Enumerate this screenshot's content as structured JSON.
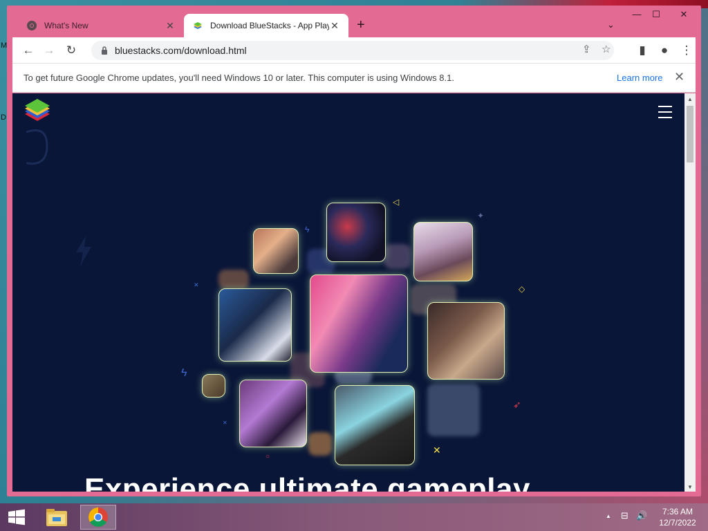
{
  "desktop": {
    "edge_letters": [
      "M",
      "D"
    ]
  },
  "window": {
    "controls": {
      "minimize": "—",
      "maximize": "☐",
      "close": "✕"
    },
    "tab_search_icon": "⌄"
  },
  "tabs": [
    {
      "title": "What's New",
      "favicon": "chrome-icon",
      "close": "✕",
      "active": false
    },
    {
      "title": "Download BlueStacks - App Player",
      "favicon": "bluestacks-icon",
      "close": "✕",
      "active": true
    }
  ],
  "new_tab": "+",
  "toolbar": {
    "back": "←",
    "forward": "→",
    "reload": "↻",
    "url": "bluestacks.com/download.html",
    "share": "⇪",
    "bookmark": "☆",
    "sidepanel": "▮",
    "profile": "●",
    "menu": "⋮"
  },
  "infobar": {
    "message": "To get future Google Chrome updates, you'll need Windows 10 or later. This computer is using Windows 8.1.",
    "link": "Learn more",
    "close": "✕"
  },
  "page": {
    "headline": "Experience ultimate gameplay"
  },
  "scrollbar": {
    "up": "▲",
    "down": "▼"
  },
  "colors": {
    "page_bg": "#0a1638",
    "window_frame": "#e26a93",
    "tile_glow": "#e7f2b8",
    "accent_yellow": "#f5e04a"
  },
  "taskbar": {
    "apps": [
      "file-explorer",
      "google-chrome"
    ],
    "tray": {
      "arrow": "▲",
      "network": "⊟",
      "volume": "🔊"
    },
    "time": "7:36 AM",
    "date": "12/7/2022"
  }
}
